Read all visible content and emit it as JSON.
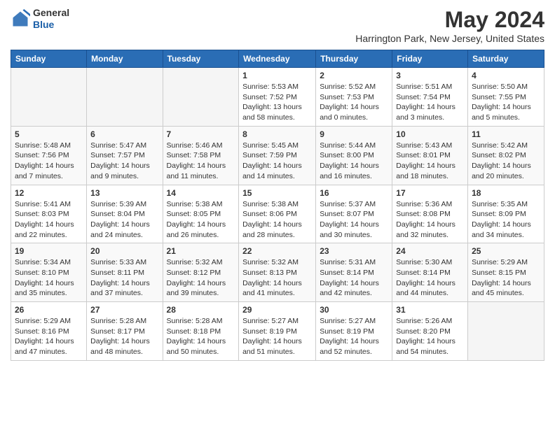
{
  "header": {
    "logo_general": "General",
    "logo_blue": "Blue",
    "month_year": "May 2024",
    "location": "Harrington Park, New Jersey, United States"
  },
  "days_of_week": [
    "Sunday",
    "Monday",
    "Tuesday",
    "Wednesday",
    "Thursday",
    "Friday",
    "Saturday"
  ],
  "weeks": [
    [
      {
        "day": "",
        "info": ""
      },
      {
        "day": "",
        "info": ""
      },
      {
        "day": "",
        "info": ""
      },
      {
        "day": "1",
        "info": "Sunrise: 5:53 AM\nSunset: 7:52 PM\nDaylight: 13 hours\nand 58 minutes."
      },
      {
        "day": "2",
        "info": "Sunrise: 5:52 AM\nSunset: 7:53 PM\nDaylight: 14 hours\nand 0 minutes."
      },
      {
        "day": "3",
        "info": "Sunrise: 5:51 AM\nSunset: 7:54 PM\nDaylight: 14 hours\nand 3 minutes."
      },
      {
        "day": "4",
        "info": "Sunrise: 5:50 AM\nSunset: 7:55 PM\nDaylight: 14 hours\nand 5 minutes."
      }
    ],
    [
      {
        "day": "5",
        "info": "Sunrise: 5:48 AM\nSunset: 7:56 PM\nDaylight: 14 hours\nand 7 minutes."
      },
      {
        "day": "6",
        "info": "Sunrise: 5:47 AM\nSunset: 7:57 PM\nDaylight: 14 hours\nand 9 minutes."
      },
      {
        "day": "7",
        "info": "Sunrise: 5:46 AM\nSunset: 7:58 PM\nDaylight: 14 hours\nand 11 minutes."
      },
      {
        "day": "8",
        "info": "Sunrise: 5:45 AM\nSunset: 7:59 PM\nDaylight: 14 hours\nand 14 minutes."
      },
      {
        "day": "9",
        "info": "Sunrise: 5:44 AM\nSunset: 8:00 PM\nDaylight: 14 hours\nand 16 minutes."
      },
      {
        "day": "10",
        "info": "Sunrise: 5:43 AM\nSunset: 8:01 PM\nDaylight: 14 hours\nand 18 minutes."
      },
      {
        "day": "11",
        "info": "Sunrise: 5:42 AM\nSunset: 8:02 PM\nDaylight: 14 hours\nand 20 minutes."
      }
    ],
    [
      {
        "day": "12",
        "info": "Sunrise: 5:41 AM\nSunset: 8:03 PM\nDaylight: 14 hours\nand 22 minutes."
      },
      {
        "day": "13",
        "info": "Sunrise: 5:39 AM\nSunset: 8:04 PM\nDaylight: 14 hours\nand 24 minutes."
      },
      {
        "day": "14",
        "info": "Sunrise: 5:38 AM\nSunset: 8:05 PM\nDaylight: 14 hours\nand 26 minutes."
      },
      {
        "day": "15",
        "info": "Sunrise: 5:38 AM\nSunset: 8:06 PM\nDaylight: 14 hours\nand 28 minutes."
      },
      {
        "day": "16",
        "info": "Sunrise: 5:37 AM\nSunset: 8:07 PM\nDaylight: 14 hours\nand 30 minutes."
      },
      {
        "day": "17",
        "info": "Sunrise: 5:36 AM\nSunset: 8:08 PM\nDaylight: 14 hours\nand 32 minutes."
      },
      {
        "day": "18",
        "info": "Sunrise: 5:35 AM\nSunset: 8:09 PM\nDaylight: 14 hours\nand 34 minutes."
      }
    ],
    [
      {
        "day": "19",
        "info": "Sunrise: 5:34 AM\nSunset: 8:10 PM\nDaylight: 14 hours\nand 35 minutes."
      },
      {
        "day": "20",
        "info": "Sunrise: 5:33 AM\nSunset: 8:11 PM\nDaylight: 14 hours\nand 37 minutes."
      },
      {
        "day": "21",
        "info": "Sunrise: 5:32 AM\nSunset: 8:12 PM\nDaylight: 14 hours\nand 39 minutes."
      },
      {
        "day": "22",
        "info": "Sunrise: 5:32 AM\nSunset: 8:13 PM\nDaylight: 14 hours\nand 41 minutes."
      },
      {
        "day": "23",
        "info": "Sunrise: 5:31 AM\nSunset: 8:14 PM\nDaylight: 14 hours\nand 42 minutes."
      },
      {
        "day": "24",
        "info": "Sunrise: 5:30 AM\nSunset: 8:14 PM\nDaylight: 14 hours\nand 44 minutes."
      },
      {
        "day": "25",
        "info": "Sunrise: 5:29 AM\nSunset: 8:15 PM\nDaylight: 14 hours\nand 45 minutes."
      }
    ],
    [
      {
        "day": "26",
        "info": "Sunrise: 5:29 AM\nSunset: 8:16 PM\nDaylight: 14 hours\nand 47 minutes."
      },
      {
        "day": "27",
        "info": "Sunrise: 5:28 AM\nSunset: 8:17 PM\nDaylight: 14 hours\nand 48 minutes."
      },
      {
        "day": "28",
        "info": "Sunrise: 5:28 AM\nSunset: 8:18 PM\nDaylight: 14 hours\nand 50 minutes."
      },
      {
        "day": "29",
        "info": "Sunrise: 5:27 AM\nSunset: 8:19 PM\nDaylight: 14 hours\nand 51 minutes."
      },
      {
        "day": "30",
        "info": "Sunrise: 5:27 AM\nSunset: 8:19 PM\nDaylight: 14 hours\nand 52 minutes."
      },
      {
        "day": "31",
        "info": "Sunrise: 5:26 AM\nSunset: 8:20 PM\nDaylight: 14 hours\nand 54 minutes."
      },
      {
        "day": "",
        "info": ""
      }
    ]
  ]
}
